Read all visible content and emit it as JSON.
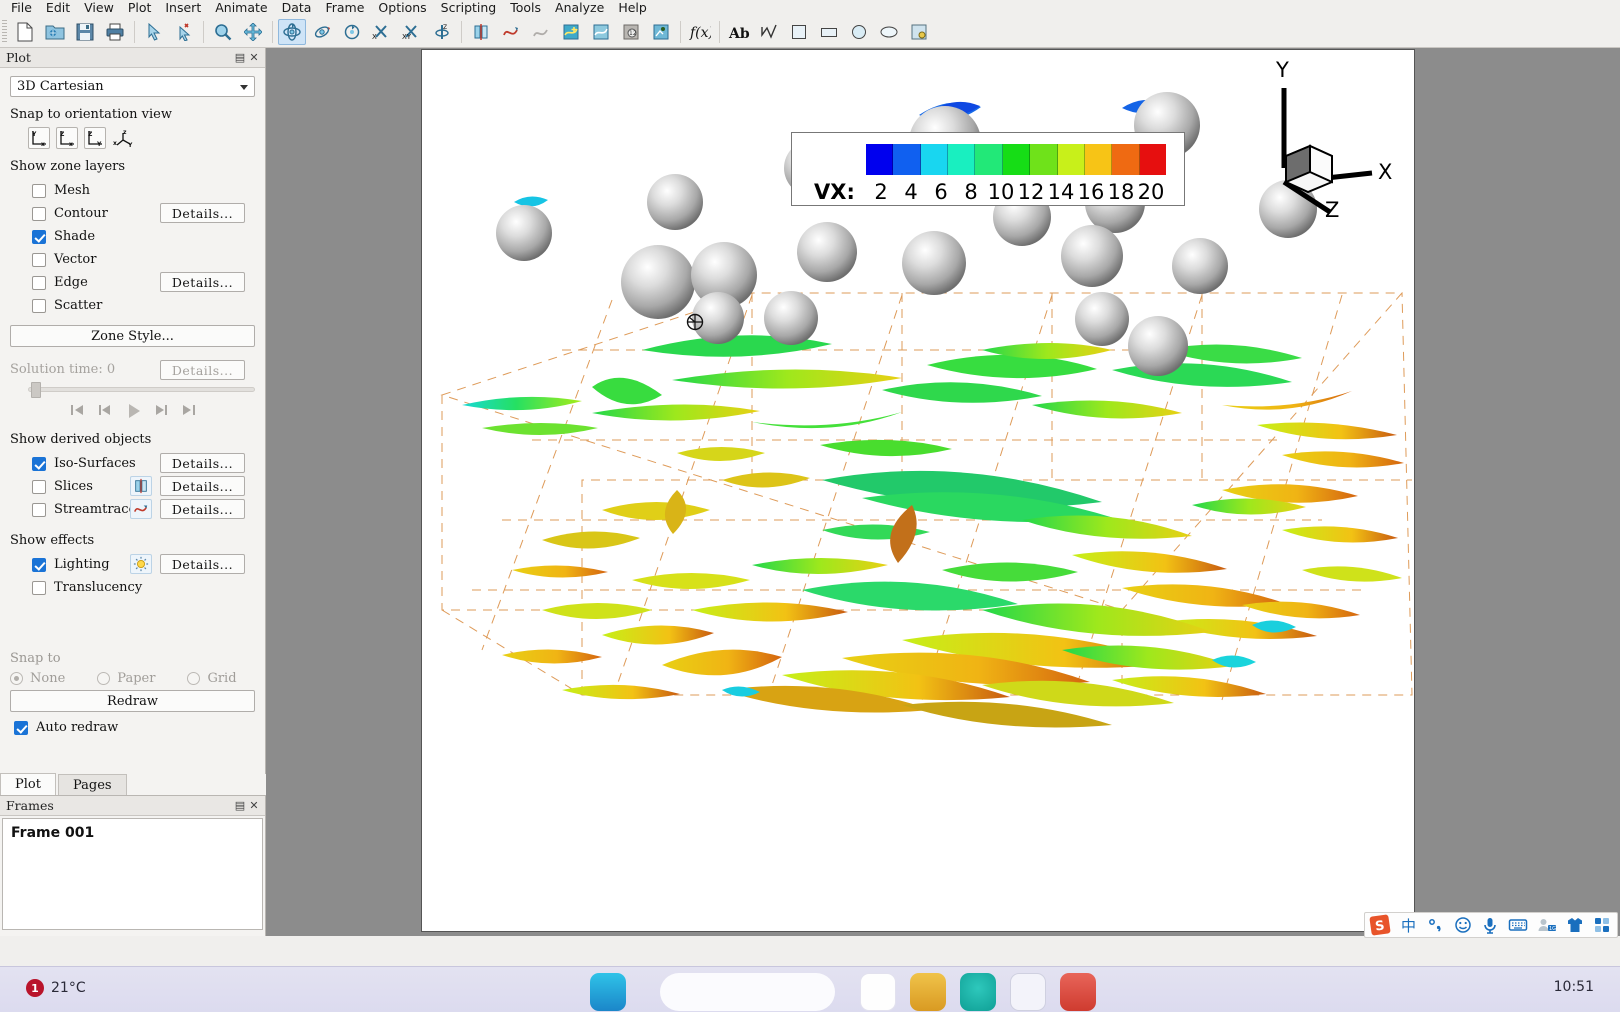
{
  "menu": {
    "items": [
      "File",
      "Edit",
      "View",
      "Plot",
      "Insert",
      "Animate",
      "Data",
      "Frame",
      "Options",
      "Scripting",
      "Tools",
      "Analyze",
      "Help"
    ]
  },
  "toolbar": {
    "groups": [
      [
        "new-file-icon",
        "open-file-icon",
        "save-icon",
        "print-icon"
      ],
      [
        "select-arrow-icon",
        "adjuster-icon",
        "zoom-magnifier-icon",
        "pan-icon",
        "rotate-3d-icon",
        "rotate-roller-icon",
        "spin-icon",
        "rotate-x-icon",
        "rotate-y-icon",
        "rotate-z-icon"
      ],
      [
        "slice-icon",
        "streamtrace-icon",
        "streamtrace-ribbon-icon",
        "contour-add-icon",
        "contour-icon",
        "probe-icon",
        "extract-icon"
      ],
      [
        "fx-icon"
      ],
      [
        "text-icon",
        "polyline-icon",
        "square-icon",
        "rectangle-icon",
        "circle-icon",
        "ellipse-icon",
        "image-icon"
      ]
    ],
    "active_tool": "rotate-3d-icon"
  },
  "plot_panel": {
    "title": "Plot",
    "plot_type": "3D Cartesian",
    "snap_orientation_label": "Snap to orientation view",
    "orientation_buttons": [
      "view-yx-icon",
      "view-zx-icon",
      "view-zy-icon",
      "view-xyz-icon"
    ],
    "zone_layers_label": "Show zone layers",
    "zone_layers": [
      {
        "label": "Mesh",
        "checked": false,
        "details": null
      },
      {
        "label": "Contour",
        "checked": false,
        "details": "Details..."
      },
      {
        "label": "Shade",
        "checked": true,
        "details": null
      },
      {
        "label": "Vector",
        "checked": false,
        "details": null
      },
      {
        "label": "Edge",
        "checked": false,
        "details": "Details..."
      },
      {
        "label": "Scatter",
        "checked": false,
        "details": null
      }
    ],
    "zone_style_label": "Zone Style...",
    "solution_time_label": "Solution time:",
    "solution_time_value": "0",
    "solution_time_details": "Details...",
    "playback": [
      "skip-to-start-icon",
      "step-back-icon",
      "play-icon",
      "step-forward-icon",
      "skip-to-end-icon"
    ],
    "derived_objects_label": "Show derived objects",
    "derived_objects": [
      {
        "label": "Iso-Surfaces",
        "checked": true,
        "icon": null,
        "details": "Details..."
      },
      {
        "label": "Slices",
        "checked": false,
        "icon": "slice-icon",
        "details": "Details..."
      },
      {
        "label": "Streamtraces",
        "checked": false,
        "icon": "streamtrace-icon",
        "details": "Details..."
      }
    ],
    "effects_label": "Show effects",
    "effects": [
      {
        "label": "Lighting",
        "checked": true,
        "icon": "lighting-icon",
        "details": "Details..."
      },
      {
        "label": "Translucency",
        "checked": false,
        "icon": null,
        "details": null
      }
    ],
    "snap_to_label": "Snap to",
    "snap_options": [
      {
        "label": "None",
        "selected": true
      },
      {
        "label": "Paper",
        "selected": false
      },
      {
        "label": "Grid",
        "selected": false
      }
    ],
    "redraw_label": "Redraw",
    "auto_redraw_label": "Auto redraw",
    "auto_redraw_checked": true,
    "tabs": [
      {
        "label": "Plot",
        "selected": true
      },
      {
        "label": "Pages",
        "selected": false
      }
    ]
  },
  "frames_panel": {
    "title": "Frames",
    "items": [
      "Frame 001"
    ]
  },
  "chart_data": {
    "type": "heatmap",
    "title": "",
    "legend_variable": "VX:",
    "legend_position": "top-center",
    "tick_labels": [
      "2",
      "4",
      "6",
      "8",
      "10",
      "12",
      "14",
      "16",
      "18",
      "20"
    ],
    "values": [
      2,
      4,
      6,
      8,
      10,
      12,
      14,
      16,
      18,
      20
    ],
    "colors": [
      "#0000ee",
      "#1060f0",
      "#19d6f0",
      "#19efc0",
      "#22e878",
      "#16dd16",
      "#6fe21a",
      "#c8f01a",
      "#f7c416",
      "#ef6a12",
      "#e60f0f"
    ],
    "xlabel": "",
    "ylabel": "",
    "axis_triad": {
      "x": "X",
      "y": "Y",
      "z": "Z"
    },
    "grid": true,
    "annotations": [
      "iso-surface vortex structures colored by VX",
      "gray spheres (particles)",
      "orange dashed bounding mesh box"
    ]
  },
  "ime_bar": {
    "items": [
      "sogou-logo-icon",
      "chinese-mode-icon",
      "punctuation-icon",
      "emoji-icon",
      "voice-input-icon",
      "soft-keyboard-icon",
      "user-icon",
      "skin-icon",
      "apps-icon"
    ]
  },
  "taskbar": {
    "weather_badge": "1",
    "weather_temp": "21°C",
    "clock_time": "10:51",
    "apps": [
      "app-1-icon",
      "search-box",
      "app-2-icon",
      "app-3-icon",
      "app-4-icon",
      "app-5-icon",
      "app-6-icon"
    ]
  }
}
